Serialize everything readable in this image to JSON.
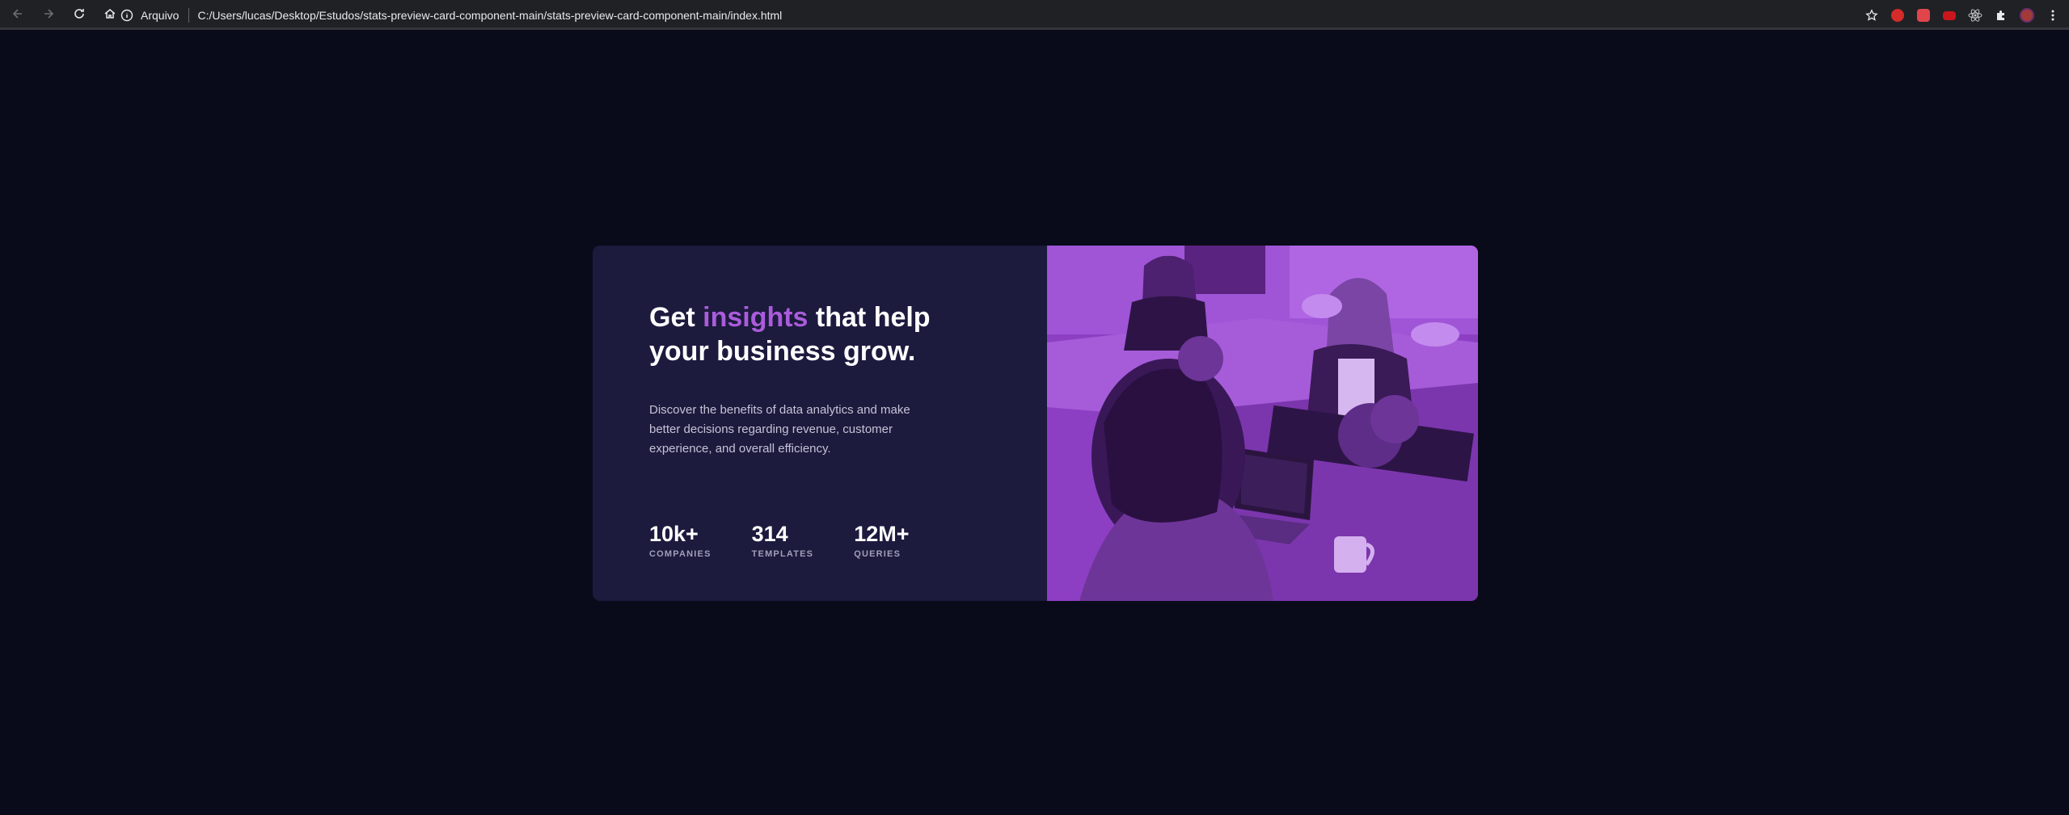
{
  "browser": {
    "location_label": "Arquivo",
    "url": "C:/Users/lucas/Desktop/Estudos/stats-preview-card-component-main/stats-preview-card-component-main/index.html",
    "icons": [
      "back-icon",
      "forward-icon",
      "reload-icon",
      "home-icon",
      "info-icon",
      "star-icon",
      "puzzle-icon",
      "menu-icon"
    ]
  },
  "card": {
    "headline_pre": "Get ",
    "headline_accent": "insights",
    "headline_post": " that help your business grow.",
    "description": "Discover the benefits of data analytics and make better decisions regarding revenue, customer experience, and overall efficiency.",
    "stats": [
      {
        "value": "10k+",
        "label": "COMPANIES"
      },
      {
        "value": "314",
        "label": "TEMPLATES"
      },
      {
        "value": "12M+",
        "label": "QUERIES"
      }
    ]
  },
  "colors": {
    "page_bg": "#090b1a",
    "card_bg": "#1c1a3d",
    "accent": "#aa5cdb",
    "overlay": "#8d3fc4"
  }
}
